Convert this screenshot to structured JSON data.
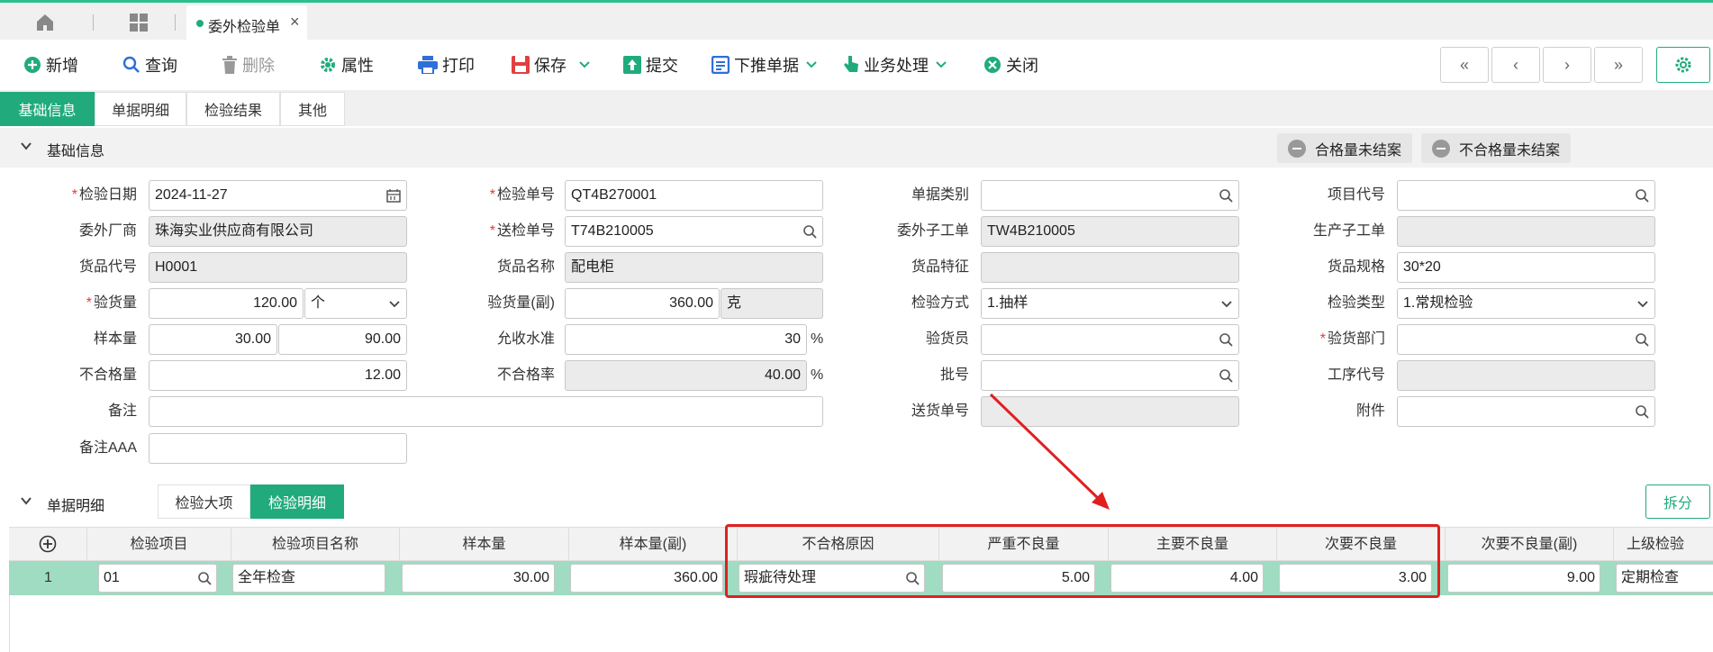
{
  "tabbar": {
    "doc_tab_label": "委外检验单",
    "close_glyph": "×"
  },
  "toolbar": {
    "new": "新增",
    "query": "查询",
    "delete": "删除",
    "properties": "属性",
    "print": "打印",
    "save": "保存",
    "submit": "提交",
    "push_down": "下推单据",
    "business": "业务处理",
    "close": "关闭",
    "nav_first": "«",
    "nav_prev": "‹",
    "nav_next": "›",
    "nav_last": "»"
  },
  "section_tabs": [
    "基础信息",
    "单据明细",
    "检验结果",
    "其他"
  ],
  "basic_group": {
    "title": "基础信息",
    "pill_qualified": "合格量未结案",
    "pill_unqualified": "不合格量未结案"
  },
  "form": {
    "inspect_date": {
      "label": "检验日期",
      "value": "2024-11-27"
    },
    "inspect_no": {
      "label": "检验单号",
      "value": "QT4B270001"
    },
    "doc_category": {
      "label": "单据类别",
      "value": ""
    },
    "project_code": {
      "label": "项目代号",
      "value": ""
    },
    "vendor": {
      "label": "委外厂商",
      "value": "珠海实业供应商有限公司"
    },
    "send_no": {
      "label": "送检单号",
      "value": "T74B210005"
    },
    "sub_order": {
      "label": "委外子工单",
      "value": "TW4B210005"
    },
    "prod_sub_order": {
      "label": "生产子工单",
      "value": ""
    },
    "goods_code": {
      "label": "货品代号",
      "value": "H0001"
    },
    "goods_name": {
      "label": "货品名称",
      "value": "配电柜"
    },
    "goods_feature": {
      "label": "货品特征",
      "value": ""
    },
    "goods_spec": {
      "label": "货品规格",
      "value": "30*20"
    },
    "qty": {
      "label": "验货量",
      "value": "120.00",
      "unit": "个"
    },
    "qty_sub": {
      "label": "验货量(副)",
      "value": "360.00",
      "unit": "克"
    },
    "method": {
      "label": "检验方式",
      "value": "1.抽样"
    },
    "type": {
      "label": "检验类型",
      "value": "1.常规检验"
    },
    "sample": {
      "label": "样本量",
      "value": "30.00",
      "value2": "90.00"
    },
    "accept_level": {
      "label": "允收水准",
      "value": "30",
      "unit": "%"
    },
    "inspector": {
      "label": "验货员",
      "value": ""
    },
    "dept": {
      "label": "验货部门",
      "value": ""
    },
    "unqualified_qty": {
      "label": "不合格量",
      "value": "12.00"
    },
    "unqualified_rate": {
      "label": "不合格率",
      "value": "40.00",
      "unit": "%"
    },
    "batch": {
      "label": "批号",
      "value": ""
    },
    "process_code": {
      "label": "工序代号",
      "value": ""
    },
    "remark": {
      "label": "备注",
      "value": ""
    },
    "delivery_no": {
      "label": "送货单号",
      "value": ""
    },
    "attachment": {
      "label": "附件",
      "value": ""
    },
    "remark_aaa": {
      "label": "备注AAA",
      "value": ""
    }
  },
  "detail_group": {
    "title": "单据明细",
    "sub_tabs": [
      "检验大项",
      "检验明细"
    ],
    "split_button": "拆分"
  },
  "grid": {
    "add_glyph": "+",
    "columns": [
      "检验项目",
      "检验项目名称",
      "样本量",
      "样本量(副)",
      "不合格原因",
      "严重不良量",
      "主要不良量",
      "次要不良量",
      "次要不良量(副)",
      "上级检验"
    ],
    "rows": [
      {
        "index": "1",
        "item": "01",
        "item_name": "全年检查",
        "sample": "30.00",
        "sample_sub": "360.00",
        "reason": "瑕疵待处理",
        "critical": "5.00",
        "major": "4.00",
        "minor": "3.00",
        "minor_sub": "9.00",
        "parent": "定期检查"
      }
    ]
  },
  "colors": {
    "accent": "#21ab7d",
    "required": "#e53935",
    "annotation": "#e02020",
    "row_highlight": "#9fdcc2"
  }
}
